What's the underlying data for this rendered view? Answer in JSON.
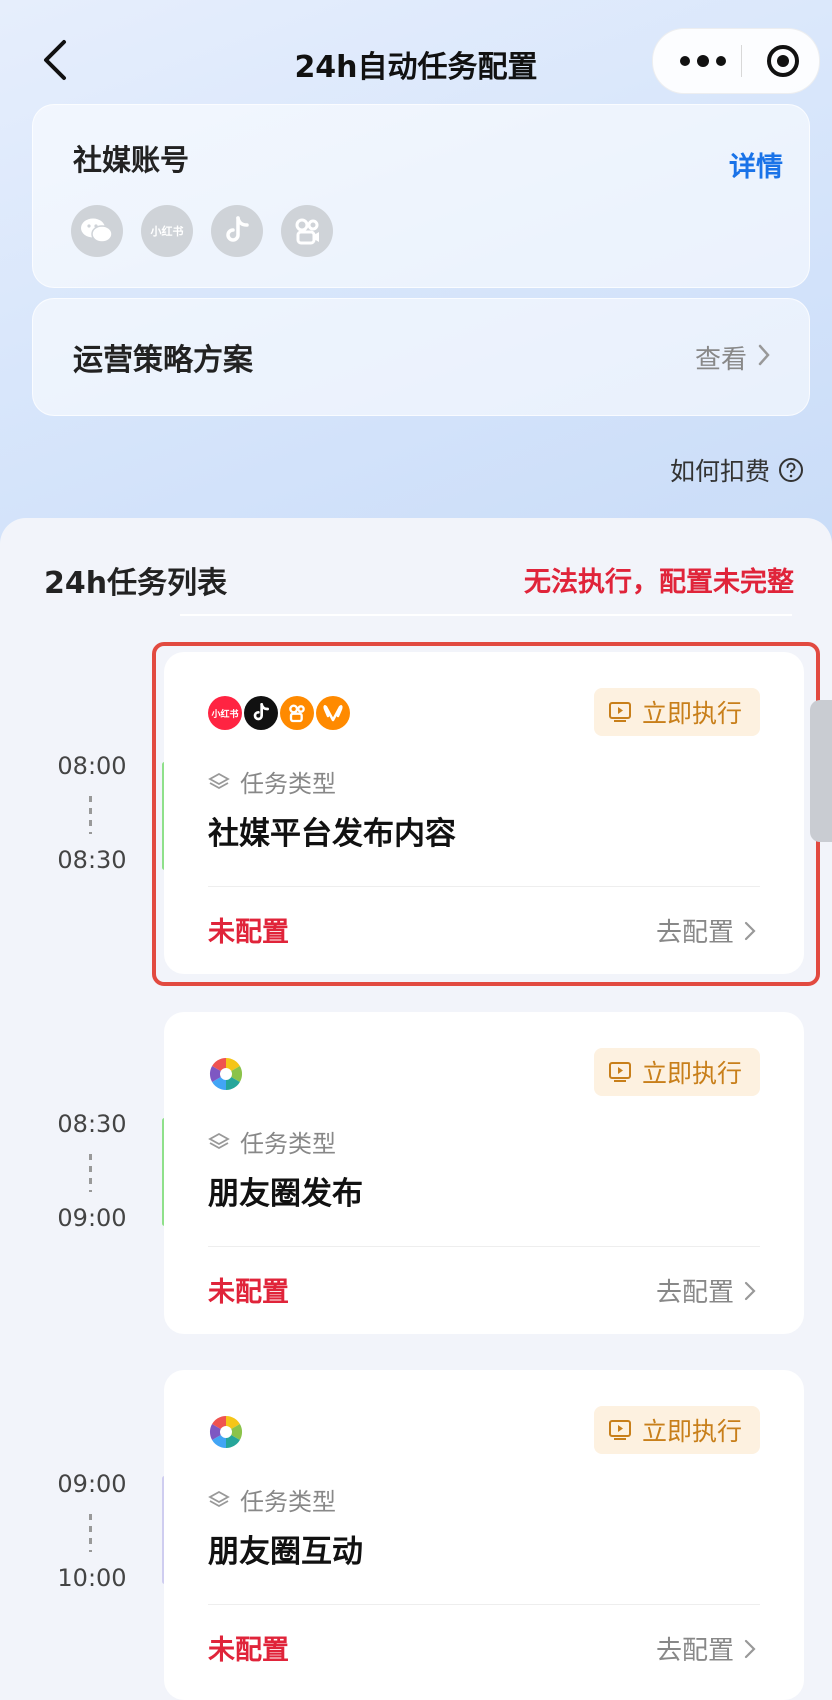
{
  "nav": {
    "title": "24h自动任务配置"
  },
  "account": {
    "label": "社媒账号",
    "detail": "详情",
    "platforms": [
      {
        "name": "wechat-icon",
        "text": ""
      },
      {
        "name": "xiaohongshu-icon",
        "text": "小红书"
      },
      {
        "name": "douyin-icon",
        "text": ""
      },
      {
        "name": "kuaishou-icon",
        "text": ""
      }
    ]
  },
  "strategy": {
    "label": "运营策略方案",
    "view": "查看"
  },
  "fee": {
    "label": "如何扣费"
  },
  "tasks": {
    "title": "24h任务列表",
    "warning": "无法执行，配置未完整",
    "items": [
      {
        "start": "08:00",
        "end": "08:30",
        "type_label": "任务类型",
        "name": "社媒平台发布内容",
        "status": "未配置",
        "action": "去配置",
        "exec": "立即执行",
        "bar_color": "#8fe08a"
      },
      {
        "start": "08:30",
        "end": "09:00",
        "type_label": "任务类型",
        "name": "朋友圈发布",
        "status": "未配置",
        "action": "去配置",
        "exec": "立即执行",
        "bar_color": "#8fe08a"
      },
      {
        "start": "09:00",
        "end": "10:00",
        "type_label": "任务类型",
        "name": "朋友圈互动",
        "status": "未配置",
        "action": "去配置",
        "exec": "立即执行",
        "bar_color": "#cfcdf0"
      }
    ]
  },
  "colors": {
    "accent_blue": "#1a73e8",
    "alert_red": "#e0243a",
    "exec_orange": "#c87f1a"
  }
}
